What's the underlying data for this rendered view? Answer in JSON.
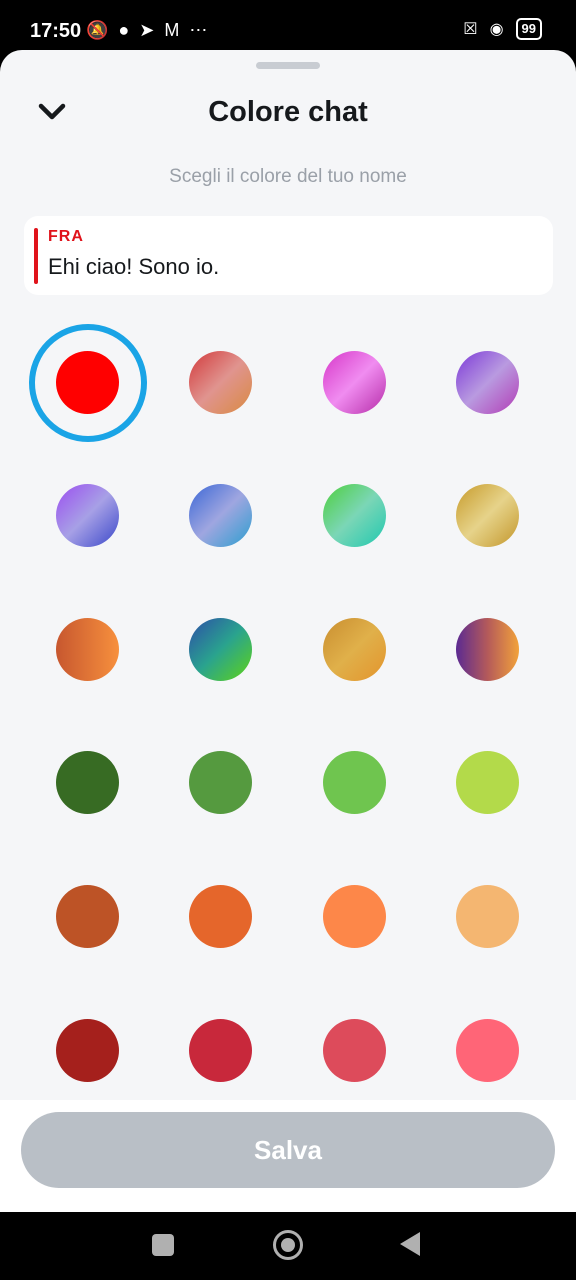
{
  "status_bar": {
    "time": "17:50",
    "icons_left": [
      "bell-off-icon",
      "chat-bubble-icon",
      "telegram-icon",
      "gmail-icon",
      "more-dots-icon"
    ],
    "battery": "99"
  },
  "header": {
    "title": "Colore chat",
    "subtitle": "Scegli il colore del tuo nome"
  },
  "preview": {
    "name": "FRA",
    "message": "Ehi ciao! Sono io.",
    "name_color": "#e0131b"
  },
  "swatches": [
    {
      "name": "red",
      "fill": "#ff0000",
      "selected": true
    },
    {
      "name": "rose-gradient",
      "fill": "linear-gradient(135deg,#d2393b,#e0948f 50%,#d98a40)"
    },
    {
      "name": "pink-gradient",
      "fill": "linear-gradient(135deg,#d636c8,#f08cf0 50%,#b52ca8)"
    },
    {
      "name": "purple-gradient",
      "fill": "linear-gradient(135deg,#7b39d8,#b99ae0 50%,#b23bb5)"
    },
    {
      "name": "violet-gradient",
      "fill": "linear-gradient(135deg,#9b4df0,#a7a0e6 50%,#3947c9)"
    },
    {
      "name": "blue-gradient",
      "fill": "linear-gradient(135deg,#3a66d6,#9fa6e0 50%,#2a9ecf)"
    },
    {
      "name": "green-gradient",
      "fill": "linear-gradient(135deg,#4ecf3c,#7bd6b6 50%,#1fc8b0)"
    },
    {
      "name": "gold-gradient",
      "fill": "linear-gradient(135deg,#c79a2a,#e6d38a 50%,#c3962a)"
    },
    {
      "name": "orange-gradient",
      "fill": "linear-gradient(90deg,#c7572f,#f7903d)"
    },
    {
      "name": "teal-lime-gradient",
      "fill": "linear-gradient(135deg,#2c4ea8,#2aa38e 50%,#5fd416)"
    },
    {
      "name": "amber-gradient",
      "fill": "linear-gradient(135deg,#c98e30,#e0b04a 50%,#e3942c)"
    },
    {
      "name": "plum-orange-gradient",
      "fill": "linear-gradient(90deg,#5b2a92,#b45a5a 50%,#f2a23a)"
    },
    {
      "name": "dark-green",
      "fill": "#376b23"
    },
    {
      "name": "green",
      "fill": "#559a3f"
    },
    {
      "name": "light-green",
      "fill": "#6fc54f"
    },
    {
      "name": "lime",
      "fill": "#b3da4a"
    },
    {
      "name": "brown-orange",
      "fill": "#bd5326"
    },
    {
      "name": "deep-orange",
      "fill": "#e5662b"
    },
    {
      "name": "orange",
      "fill": "#fd8749"
    },
    {
      "name": "peach",
      "fill": "#f4b671"
    },
    {
      "name": "dark-red",
      "fill": "#a5201c"
    },
    {
      "name": "crimson",
      "fill": "#c8283b"
    },
    {
      "name": "coral-red",
      "fill": "#dd4b5b"
    },
    {
      "name": "salmon-pink",
      "fill": "#ff6577"
    }
  ],
  "footer": {
    "save_label": "Salva"
  }
}
